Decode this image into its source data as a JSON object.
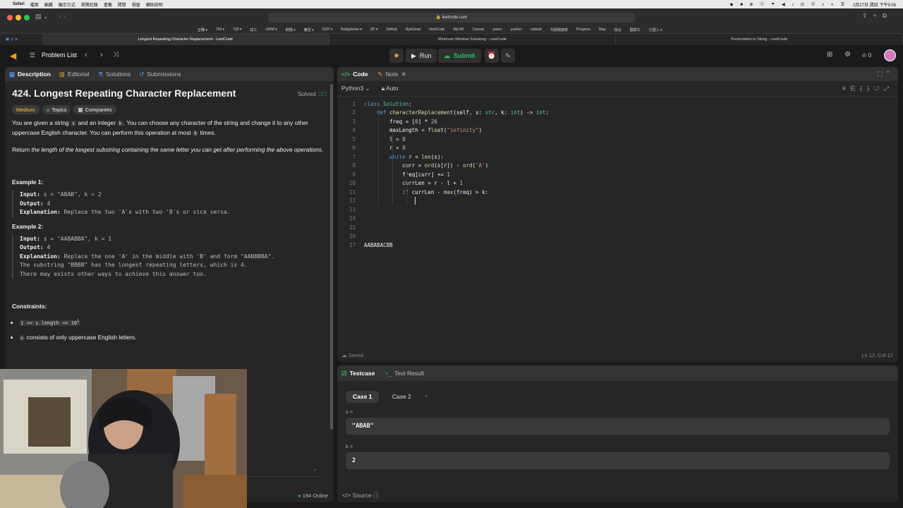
{
  "menubar": {
    "app": "Safari",
    "items": [
      "檔案",
      "編輯",
      "顯示方式",
      "瀏覽記錄",
      "書籤",
      "開發",
      "視窗",
      "輔助說明"
    ],
    "datetime": "2月27日 週四 下午9:06"
  },
  "browser": {
    "url": "leetcode.com",
    "bookmarks": [
      "正職 ▾",
      "759 ▾",
      "739 ▾",
      "找工",
      "UWM ▾",
      "刷題 ▾",
      "實習 ▾",
      "GCP ▾",
      "Budgetwise ▾",
      "SP ▾",
      "GitHub",
      "ByteGrad",
      "NextCode",
      "MyUW",
      "Canvas",
      "yoson",
      "yushan",
      "outlook",
      "代刷題總表",
      "Progress",
      "Map",
      "後台",
      "翻譯文",
      "已匯入 ▾"
    ],
    "tabs": [
      {
        "label": "Longest Repeating Character Replacement - LeetCode",
        "active": true
      },
      {
        "label": "Minimum Window Substring - LeetCode",
        "active": false
      },
      {
        "label": "Permutation in String - LeetCode",
        "active": false
      }
    ]
  },
  "header": {
    "problem_list": "Problem List",
    "run": "Run",
    "submit": "Submit",
    "streak": "0"
  },
  "desc_tabs": [
    "Description",
    "Editorial",
    "Solutions",
    "Submissions"
  ],
  "problem": {
    "title": "424. Longest Repeating Character Replacement",
    "status": "Solved",
    "difficulty": "Medium",
    "topics": "Topics",
    "companies": "Companies",
    "p1a": "You are given a string ",
    "p1b": "s",
    "p1c": " and an integer ",
    "p1d": "k",
    "p1e": ". You can choose any character of the string and change it to any other uppercase English character. You can perform this operation at most ",
    "p1f": "k",
    "p1g": " times.",
    "p2a": "Return ",
    "p2b": "the length of the longest substring containing the same letter you can get after performing the above operations",
    "p2c": ".",
    "ex1_title": "Example 1:",
    "ex1_input_label": "Input:",
    "ex1_input": " s = \"ABAB\", k = 2",
    "ex1_output_label": "Output:",
    "ex1_output": " 4",
    "ex1_expl_label": "Explanation:",
    "ex1_expl": " Replace the two 'A's with two 'B's or vice versa.",
    "ex2_title": "Example 2:",
    "ex2_input_label": "Input:",
    "ex2_input": " s = \"AABABBA\", k = 1",
    "ex2_output_label": "Output:",
    "ex2_output": " 4",
    "ex2_expl_label": "Explanation:",
    "ex2_expl": " Replace the one 'A' in the middle with 'B' and form \"AABBBBA\".",
    "ex2_l2": "The substring \"BBBB\" has the longest repeating letters, which is 4.",
    "ex2_l3": "There may exists other ways to achieve this answer too.",
    "constraints_title": "Constraints:",
    "c1": "1 <= s.length <= 10",
    "c1sup": "5",
    "c2a": "s",
    "c2b": " consists of only uppercase English letters.",
    "online": "194 Online"
  },
  "code_panel": {
    "tab_code": "Code",
    "tab_note": "Note",
    "language": "Python3",
    "mode": "Auto",
    "saved": "Saved",
    "cursor": "Ln 12, Col 17"
  },
  "testcase_panel": {
    "tab_testcase": "Testcase",
    "tab_result": "Test Result",
    "case1": "Case 1",
    "case2": "Case 2",
    "s_label": "s =",
    "s_value": "\"ABAB\"",
    "k_label": "k =",
    "k_value": "2",
    "source": "Source"
  },
  "colors": {
    "accent_green": "#2cbb5d",
    "medium": "#ffc01e",
    "bg": "#1a1a1a",
    "panel": "#262626"
  }
}
